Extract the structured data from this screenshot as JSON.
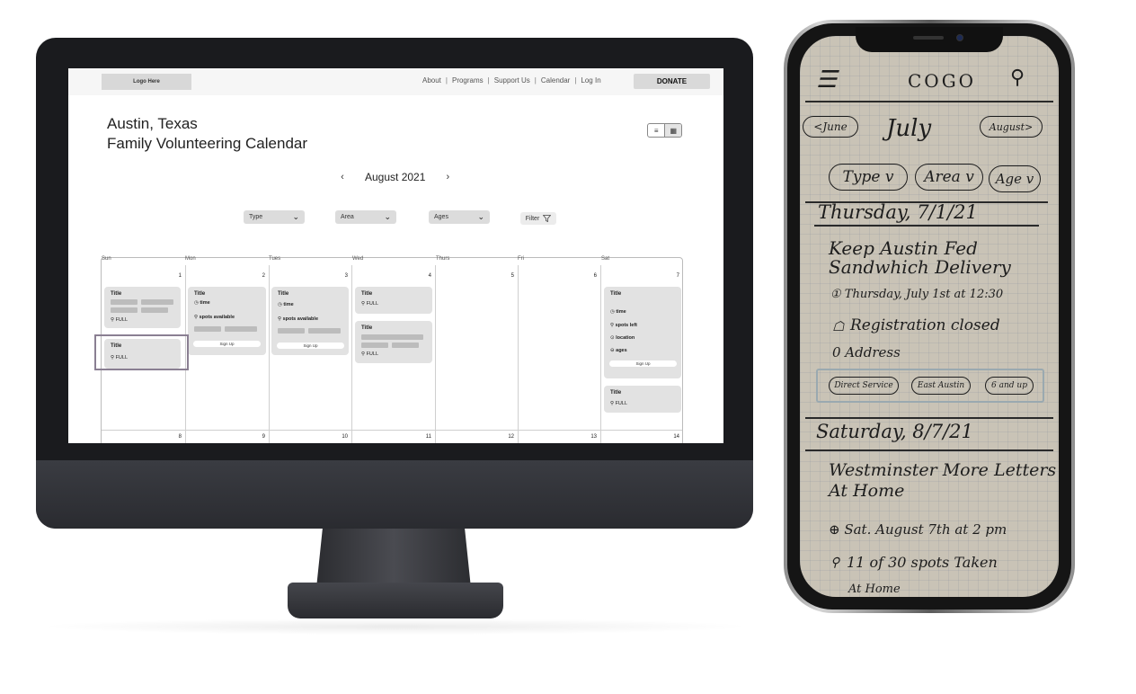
{
  "desktop": {
    "nav": {
      "logo": "Logo Here",
      "links": [
        "About",
        "Programs",
        "Support Us",
        "Calendar",
        "Log In"
      ],
      "separator": "|",
      "donate": "DONATE"
    },
    "title_line1": "Austin, Texas",
    "title_line2": "Family Volunteering Calendar",
    "view_toggle": {
      "list_icon": "≡",
      "calendar_icon": "▦"
    },
    "month_nav": {
      "prev": "‹",
      "label": "August 2021",
      "next": "›"
    },
    "filters": [
      {
        "label": "Type"
      },
      {
        "label": "Area"
      },
      {
        "label": "Ages"
      }
    ],
    "filter_button": "Filter",
    "filter_chevron": "⌄",
    "calendar": {
      "days": [
        "Sun",
        "Mon",
        "Tues",
        "Wed",
        "Thurs",
        "Fri",
        "Sat"
      ],
      "week1": [
        "1",
        "2",
        "3",
        "4",
        "5",
        "6",
        "7"
      ],
      "week2": [
        "8",
        "9",
        "10",
        "11",
        "12",
        "13",
        "14"
      ],
      "events": {
        "sun_1": {
          "title": "Title",
          "status": "FULL"
        },
        "sun_2": {
          "title": "Title",
          "status": "FULL"
        },
        "mon_1": {
          "title": "Title",
          "time": "time",
          "spots": "spots available",
          "signup": "Sign Up"
        },
        "tue_1": {
          "title": "Title",
          "time": "time",
          "spots": "spots available",
          "signup": "Sign Up"
        },
        "wed_1": {
          "title": "Title",
          "status": "FULL"
        },
        "wed_2": {
          "title": "Title",
          "status": "FULL"
        },
        "sat_1": {
          "title": "Title",
          "time": "time",
          "spots": "spots left",
          "location": "location",
          "ages": "ages",
          "signup": "Sign Up"
        },
        "sat_2": {
          "title": "Title",
          "status": "FULL"
        }
      }
    }
  },
  "phone": {
    "brand": "COGO",
    "menu_icon": "☰",
    "search_icon": "⚲",
    "month_prev": "<June",
    "month": "July",
    "month_next": "August>",
    "filters": [
      "Type v",
      "Area v",
      "Age v"
    ],
    "day1": "Thursday, 7/1/21",
    "event1_title_1": "Keep Austin Fed",
    "event1_title_2": "Sandwhich Delivery",
    "event1_time": "① Thursday, July 1st at 12:30",
    "event1_reg": "Registration closed",
    "event1_addr": "0 Address",
    "event1_tags": [
      "Direct Service",
      "East Austin",
      "6 and up"
    ],
    "day2": "Saturday, 8/7/21",
    "event2_title_1": "Westminster More Letters",
    "event2_title_2": "At Home",
    "event2_time": "⊕ Sat. August 7th at 2 pm",
    "event2_spots": "11 of 30 spots Taken",
    "event2_loc": "At Home"
  }
}
